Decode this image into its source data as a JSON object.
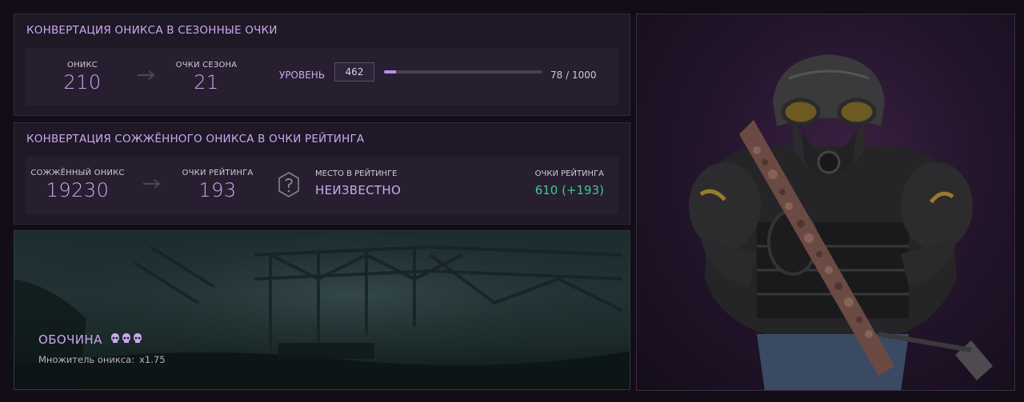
{
  "onyx_conversion": {
    "title": "КОНВЕРТАЦИЯ ОНИКСА В СЕЗОННЫЕ ОЧКИ",
    "onyx_label": "ОНИКС",
    "onyx_value": "210",
    "season_points_label": "ОЧКИ СЕЗОНА",
    "season_points_value": "21",
    "level_label": "УРОВЕНЬ",
    "level_value": "462",
    "level_progress_text": "78 / 1000",
    "level_progress_fraction": 0.078
  },
  "burned_conversion": {
    "title": "КОНВЕРТАЦИЯ СОЖЖЁННОГО ОНИКСА В ОЧКИ РЕЙТИНГА",
    "burned_label": "СОЖЖЁННЫЙ ОНИКС",
    "burned_value": "19230",
    "rating_points_label": "ОЧКИ РЕЙТИНГА",
    "rating_points_value": "193",
    "rank_label": "МЕСТО В РЕЙТИНГЕ",
    "rank_value": "НЕИЗВЕСТНО",
    "rating_total_label": "ОЧКИ РЕЙТИНГА",
    "rating_total_value": "610 (+193)"
  },
  "map": {
    "name": "ОБОЧИНА",
    "difficulty_skulls": 3,
    "multiplier_label": "Множитель оникса:",
    "multiplier_value": "x1.75"
  },
  "colors": {
    "accent": "#c9a8f0",
    "positive": "#3fc68c",
    "panel": "#1f1826"
  },
  "icons": {
    "arrow": "arrow-right-icon",
    "rank": "rank-unknown-icon",
    "skull": "skull-icon"
  }
}
